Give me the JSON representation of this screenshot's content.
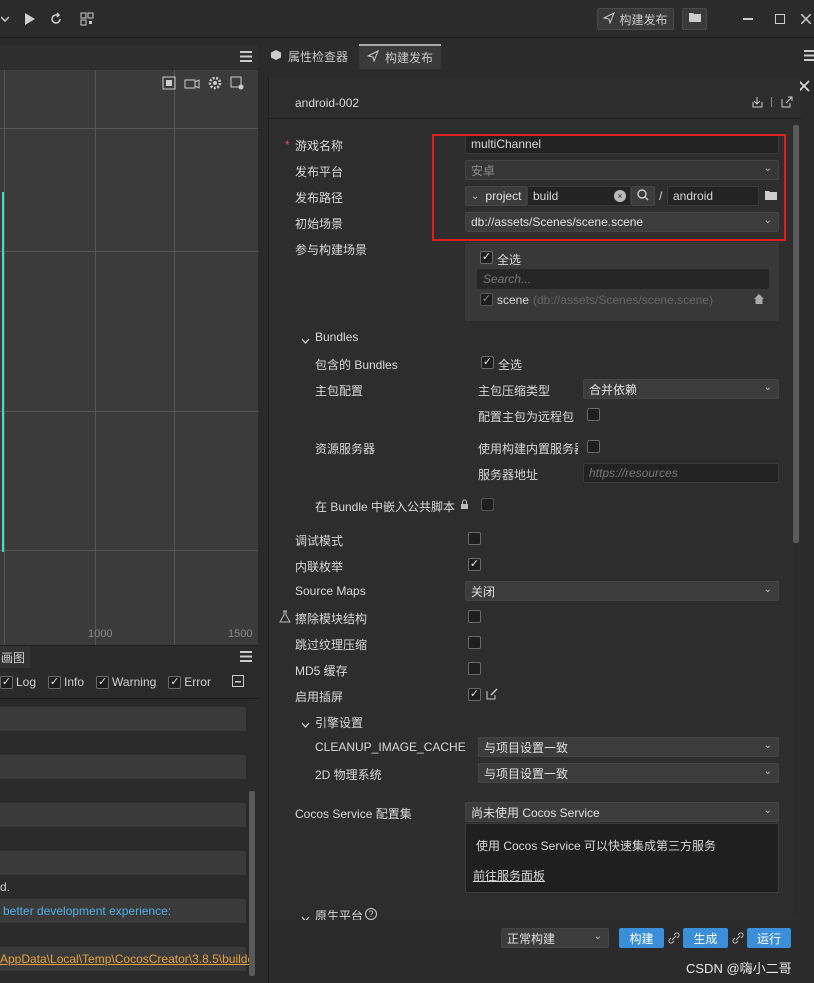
{
  "topbar": {
    "build_publish_label": "构建发布"
  },
  "scene": {
    "axis_labels": [
      "1000",
      "1500"
    ]
  },
  "console": {
    "tab_label": "画图",
    "filters": [
      {
        "label": "Log",
        "checked": true
      },
      {
        "label": "Info",
        "checked": true
      },
      {
        "label": "Warning",
        "checked": true
      },
      {
        "label": "Error",
        "checked": true
      }
    ],
    "lines": [
      "d.",
      "better development experience:",
      "AppData\\Local\\Temp\\CocosCreator\\3.8.5\\builde"
    ]
  },
  "right_tabs": {
    "inspector": "属性检查器",
    "build": "构建发布"
  },
  "build": {
    "config_name": "android-002",
    "game_name_label": "游戏名称",
    "game_name_required": "*",
    "game_name_value": "multiChannel",
    "platform_label": "发布平台",
    "platform_value": "安卓",
    "path_label": "发布路径",
    "path_prefix": "project",
    "path_value": "build",
    "path_sep": "/",
    "path_suffix": "android",
    "start_scene_label": "初始场景",
    "start_scene_value": "db://assets/Scenes/scene.scene",
    "scenes_label": "参与构建场景",
    "select_all": "全选",
    "scene_search_placeholder": "Search...",
    "scene_item_name": "scene",
    "scene_item_path": "(db://assets/Scenes/scene.scene)",
    "bundles_section": "Bundles",
    "included_bundles_label": "包含的 Bundles",
    "included_bundles_select_all": "全选",
    "main_pkg_label": "主包配置",
    "compress_type_label": "主包压缩类型",
    "compress_type_value": "合并依赖",
    "main_remote_label": "配置主包为远程包",
    "resource_server_label": "资源服务器",
    "use_builtin_server_label": "使用构建内置服务器",
    "server_address_label": "服务器地址",
    "server_address_placeholder": "https://resources",
    "embed_script_label": "在 Bundle 中嵌入公共脚本",
    "debug_label": "调试模式",
    "inline_enum_label": "内联枚举",
    "source_maps_label": "Source Maps",
    "source_maps_value": "关闭",
    "erase_module_label": "擦除模块结构",
    "skip_compress_label": "跳过纹理压缩",
    "md5_label": "MD5 缓存",
    "splash_label": "启用插屏",
    "engine_section": "引擎设置",
    "cleanup_label": "CLEANUP_IMAGE_CACHE",
    "cleanup_value": "与项目设置一致",
    "physics_label": "2D 物理系统",
    "physics_value": "与项目设置一致",
    "cocos_service_label": "Cocos Service 配置集",
    "cocos_service_value": "尚未使用 Cocos Service",
    "cocos_service_tip": "使用 Cocos Service 可以快速集成第三方服务",
    "cocos_service_link": "前往服务面板",
    "native_section": "原生平台",
    "build_mode_value": "正常构建",
    "build_btn": "构建",
    "generate_btn": "生成",
    "run_btn": "运行"
  },
  "watermark": "CSDN @嗨小二哥",
  "colors": {
    "accent_blue": "#3b8fd9",
    "highlight_red": "#e02020",
    "link_orange": "#e8a23c",
    "info_blue": "#4fb0e8",
    "scene_frame": "#40e0c0"
  }
}
